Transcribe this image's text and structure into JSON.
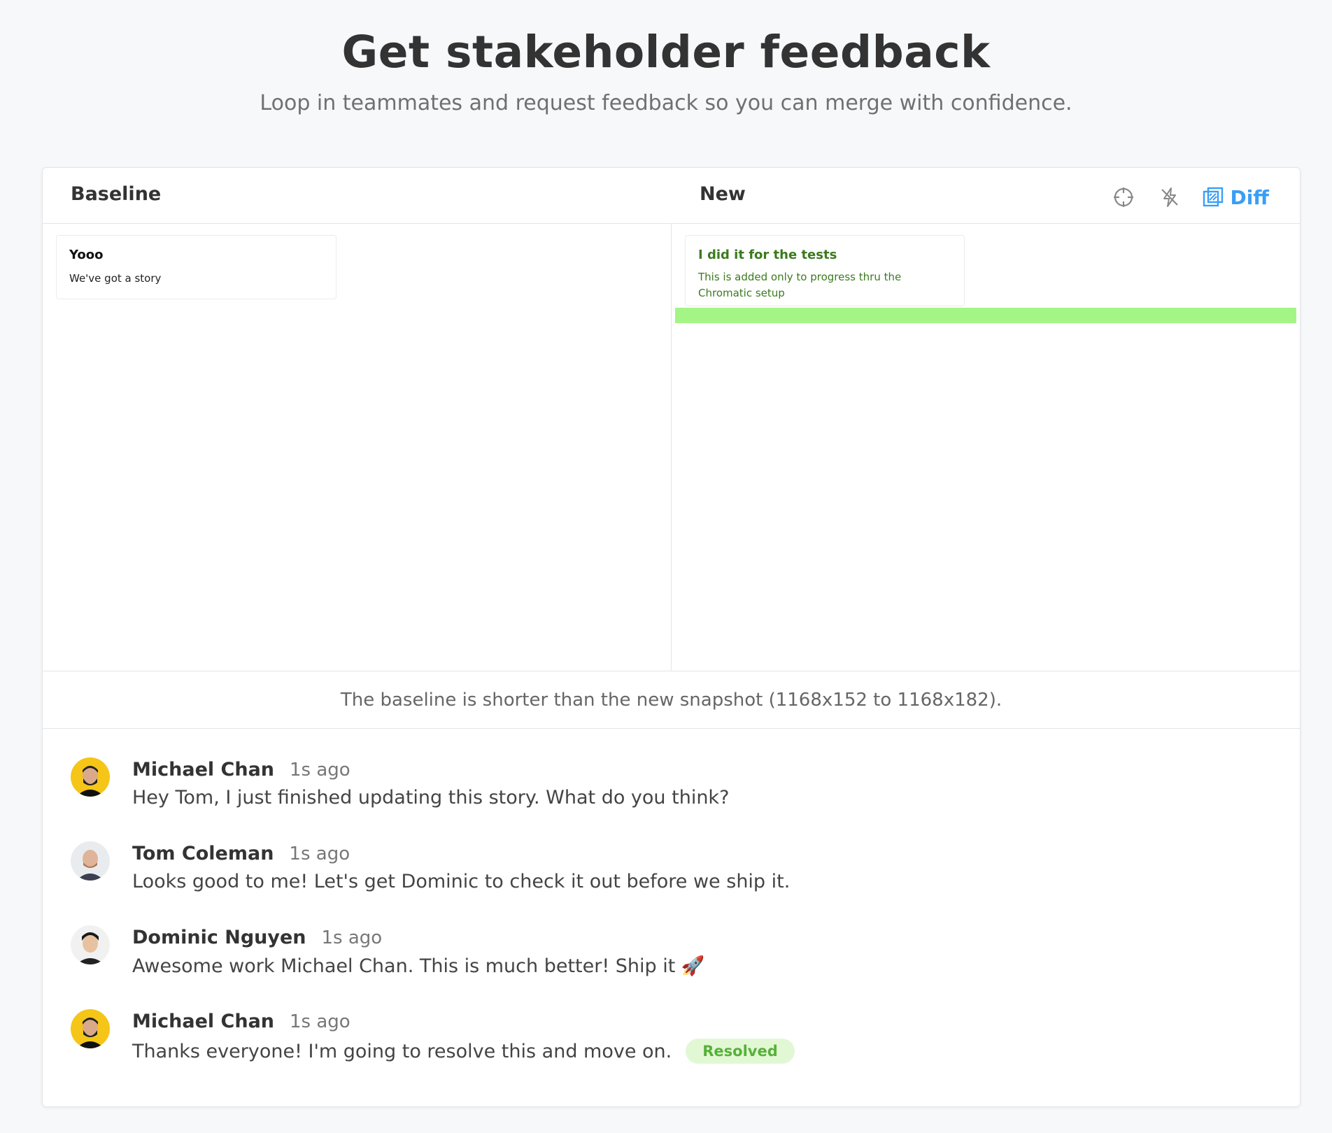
{
  "header": {
    "title": "Get stakeholder feedback",
    "subtitle": "Loop in teammates and request feedback so you can merge with confidence."
  },
  "review": {
    "baseline_label": "Baseline",
    "new_label": "New",
    "tools": {
      "target_icon": "crosshair-icon",
      "strobe_icon": "strobe-off-icon",
      "diff_icon": "diff-layers-icon",
      "diff_label": "Diff"
    },
    "baseline_story": {
      "title": "Yooo",
      "body": "We've got a story"
    },
    "new_story": {
      "title": "I did it for the tests",
      "body": "This is added only to progress thru the Chromatic setup"
    },
    "size_note": "The baseline is shorter than the new snapshot (1168x152 to 1168x182).",
    "colors": {
      "accent": "#3a9ef5",
      "diff_highlight": "#a3f585",
      "resolved_bg": "#e2f8d5",
      "resolved_text": "#57b13a"
    }
  },
  "comments": [
    {
      "author": "Michael Chan",
      "time": "1s ago",
      "text": "Hey Tom, I just finished updating this story. What do you think?",
      "avatar": "michael-chan-avatar"
    },
    {
      "author": "Tom Coleman",
      "time": "1s ago",
      "text": "Looks good to me! Let's get Dominic to check it out before we ship it.",
      "avatar": "tom-coleman-avatar"
    },
    {
      "author": "Dominic Nguyen",
      "time": "1s ago",
      "text": "Awesome work Michael Chan. This is much better! Ship it 🚀",
      "avatar": "dominic-nguyen-avatar"
    },
    {
      "author": "Michael Chan",
      "time": "1s ago",
      "text": "Thanks everyone! I'm going to resolve this and move on.",
      "avatar": "michael-chan-avatar",
      "badge": "Resolved"
    }
  ]
}
